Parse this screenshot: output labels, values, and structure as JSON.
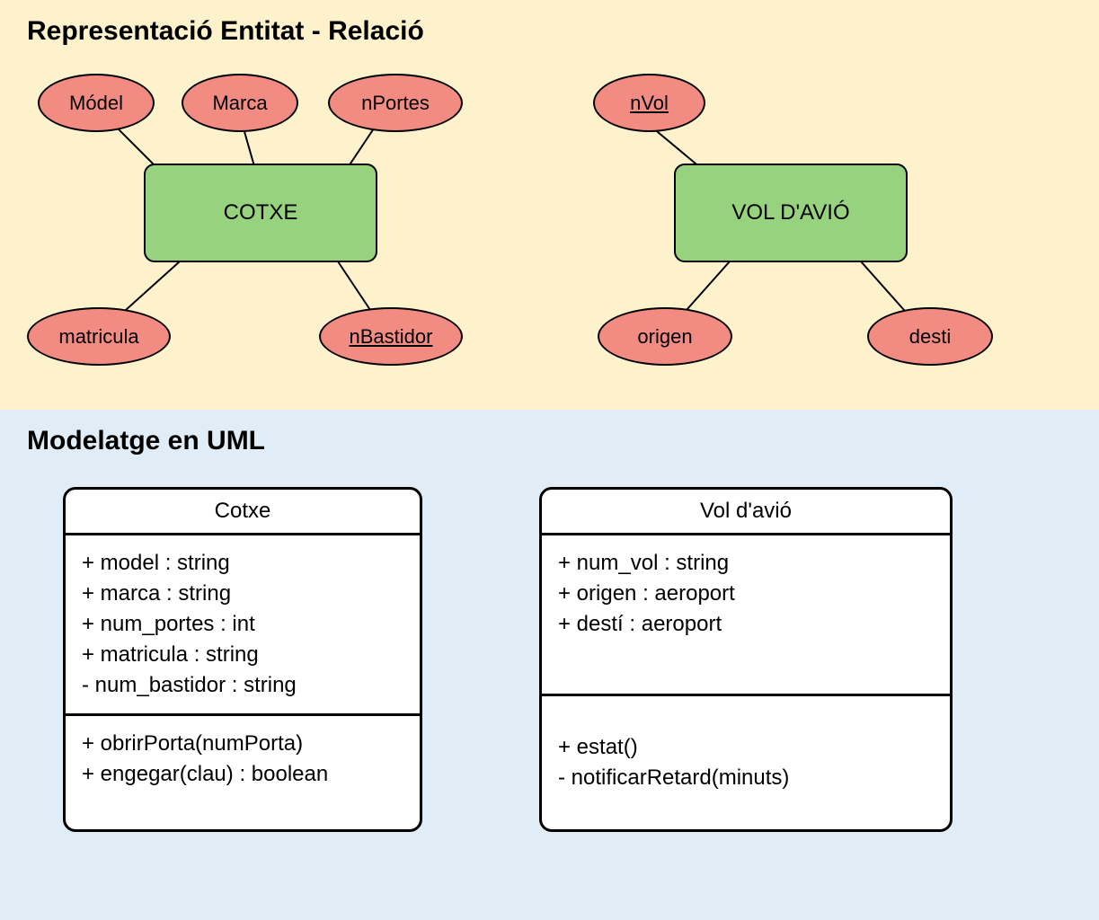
{
  "er": {
    "title": "Representació Entitat - Relació",
    "entity1": "COTXE",
    "entity2": "VOL D'AVIÓ",
    "attrs1": {
      "model": "Módel",
      "marca": "Marca",
      "nportes": "nPortes",
      "matricula": "matricula",
      "nbastidor": "nBastidor"
    },
    "attrs2": {
      "nvol": "nVol",
      "origen": "origen",
      "desti": "desti"
    }
  },
  "uml": {
    "title": "Modelatge en UML",
    "box1": {
      "name": "Cotxe",
      "attrs": [
        "+ model : string",
        "+ marca : string",
        "+ num_portes : int",
        "+ matricula : string",
        "- num_bastidor : string"
      ],
      "ops": [
        "+ obrirPorta(numPorta)",
        "+ engegar(clau) : boolean"
      ]
    },
    "box2": {
      "name": "Vol d'avió",
      "attrs": [
        "+ num_vol : string",
        "+ origen : aeroport",
        "+ destí : aeroport"
      ],
      "ops": [
        "+ estat()",
        "- notificarRetard(minuts)"
      ]
    }
  }
}
